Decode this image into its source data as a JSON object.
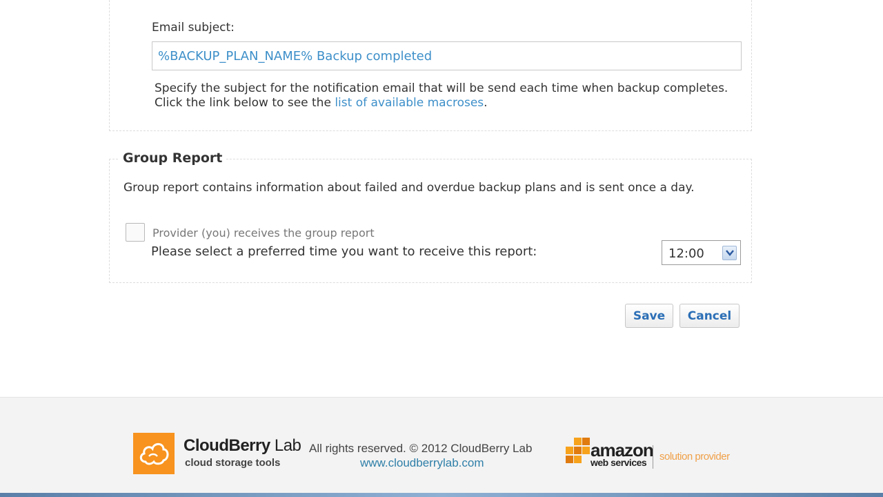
{
  "email_section": {
    "subject_label": "Email subject:",
    "subject_value": "%BACKUP_PLAN_NAME% Backup completed",
    "help_text_before": "Specify the subject for the notification email that will be send each time when backup completes. Click the link below to see the ",
    "help_link": "list of available macroses",
    "help_text_after": "."
  },
  "group_report": {
    "title": "Group Report",
    "description": "Group report contains information about failed and overdue backup plans and is sent once a day.",
    "checkbox_label": "Provider (you) receives the group report",
    "checkbox_checked": false,
    "time_prompt": "Please select a preferred time you want to receive this report:",
    "time_value": "12:00"
  },
  "actions": {
    "save_label": "Save",
    "cancel_label": "Cancel"
  },
  "footer": {
    "brand_name_bold": "CloudBerry",
    "brand_name_rest": " Lab",
    "brand_tagline": "cloud storage tools",
    "copyright": "All rights reserved. © 2012 CloudBerry Lab",
    "site_link": "www.cloudberrylab.com",
    "aws_word": "amazon",
    "aws_sub": "web services",
    "aws_provider": "solution provider",
    "brand_color": "#f7931e"
  }
}
